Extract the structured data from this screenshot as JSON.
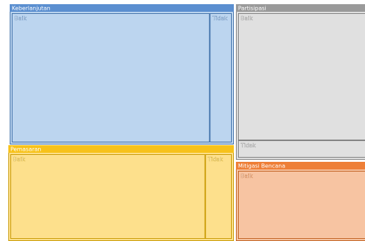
{
  "chart_data": {
    "type": "treemap",
    "title": "",
    "groups": [
      {
        "name": "Keberlanjutan",
        "header_color": "#5b8fd0",
        "border_color": "#3f6fa8",
        "fill_color": "#bcd5ef",
        "items": [
          {
            "label": "Baik",
            "value": 90
          },
          {
            "label": "Tidak",
            "value": 10
          }
        ]
      },
      {
        "name": "Partisipasi",
        "header_color": "#9a9a9a",
        "border_color": "#7d7d7d",
        "fill_color": "#e0e0e0",
        "items": [
          {
            "label": "Baik",
            "value": 88
          },
          {
            "label": "Tidak",
            "value": 12
          }
        ]
      },
      {
        "name": "Pemasaran",
        "header_color": "#f7c21b",
        "border_color": "#c79800",
        "fill_color": "#fde08c",
        "items": [
          {
            "label": "Baik",
            "value": 88
          },
          {
            "label": "Tidak",
            "value": 12
          }
        ]
      },
      {
        "name": "Mitigasi Bencana",
        "header_color": "#ee7f37",
        "border_color": "#c05f1f",
        "fill_color": "#f7c4a2",
        "items": [
          {
            "label": "Baik",
            "value": 100
          }
        ]
      }
    ]
  }
}
